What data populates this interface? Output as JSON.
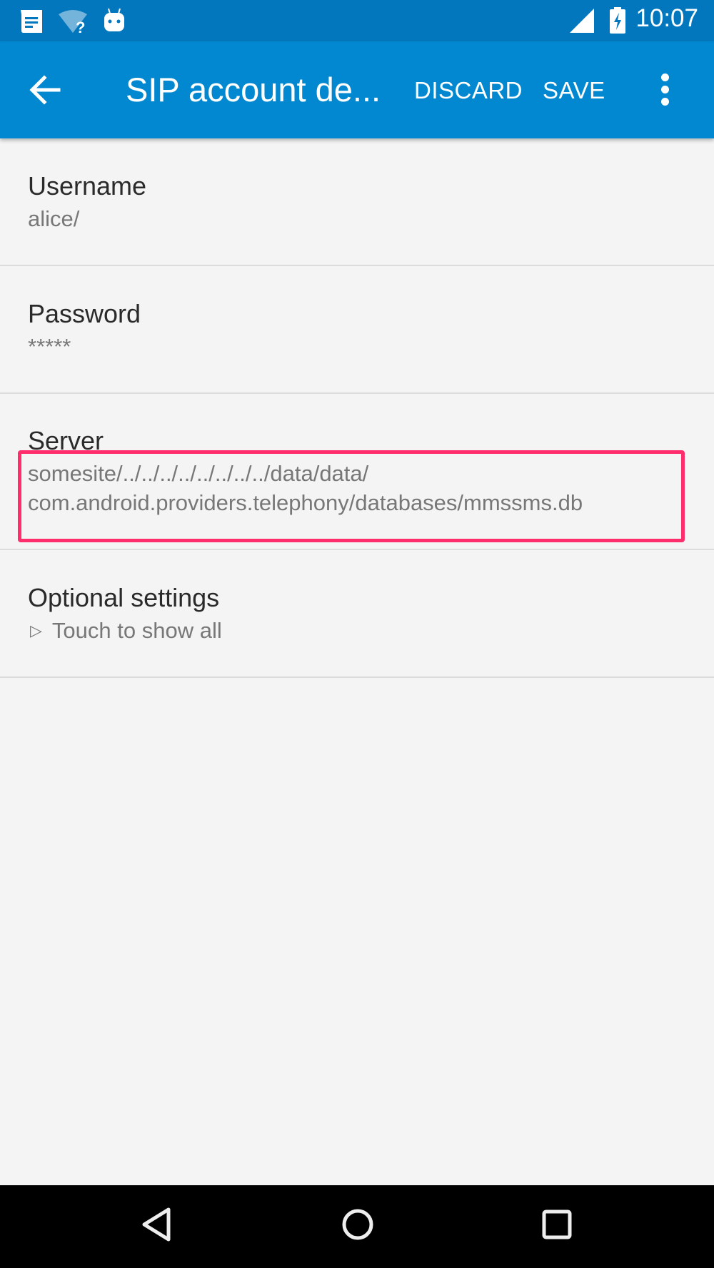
{
  "status_bar": {
    "time": "10:07",
    "left_icons": [
      "messaging-notification-icon",
      "wifi-unknown-icon",
      "android-debug-icon"
    ],
    "right_icons": [
      "cell-signal-icon",
      "battery-charging-icon"
    ]
  },
  "app_bar": {
    "title": "SIP account de...",
    "discard_label": "DISCARD",
    "save_label": "SAVE",
    "colors": {
      "status_bar": "#0277bd",
      "app_bar": "#0288d1"
    }
  },
  "preferences": {
    "username": {
      "title": "Username",
      "value": "alice/"
    },
    "password": {
      "title": "Password",
      "value": "*****"
    },
    "server": {
      "title": "Server",
      "value_line1": "somesite/../../../../../../../../data/data/",
      "value_line2": "com.android.providers.telephony/databases/mmssms.db"
    },
    "optional": {
      "title": "Optional settings",
      "summary": "Touch to show all"
    }
  },
  "annotation": {
    "highlight_color": "#ff2d6b",
    "target": "server-value"
  },
  "nav_bar": {
    "buttons": [
      "back",
      "home",
      "recents"
    ]
  }
}
